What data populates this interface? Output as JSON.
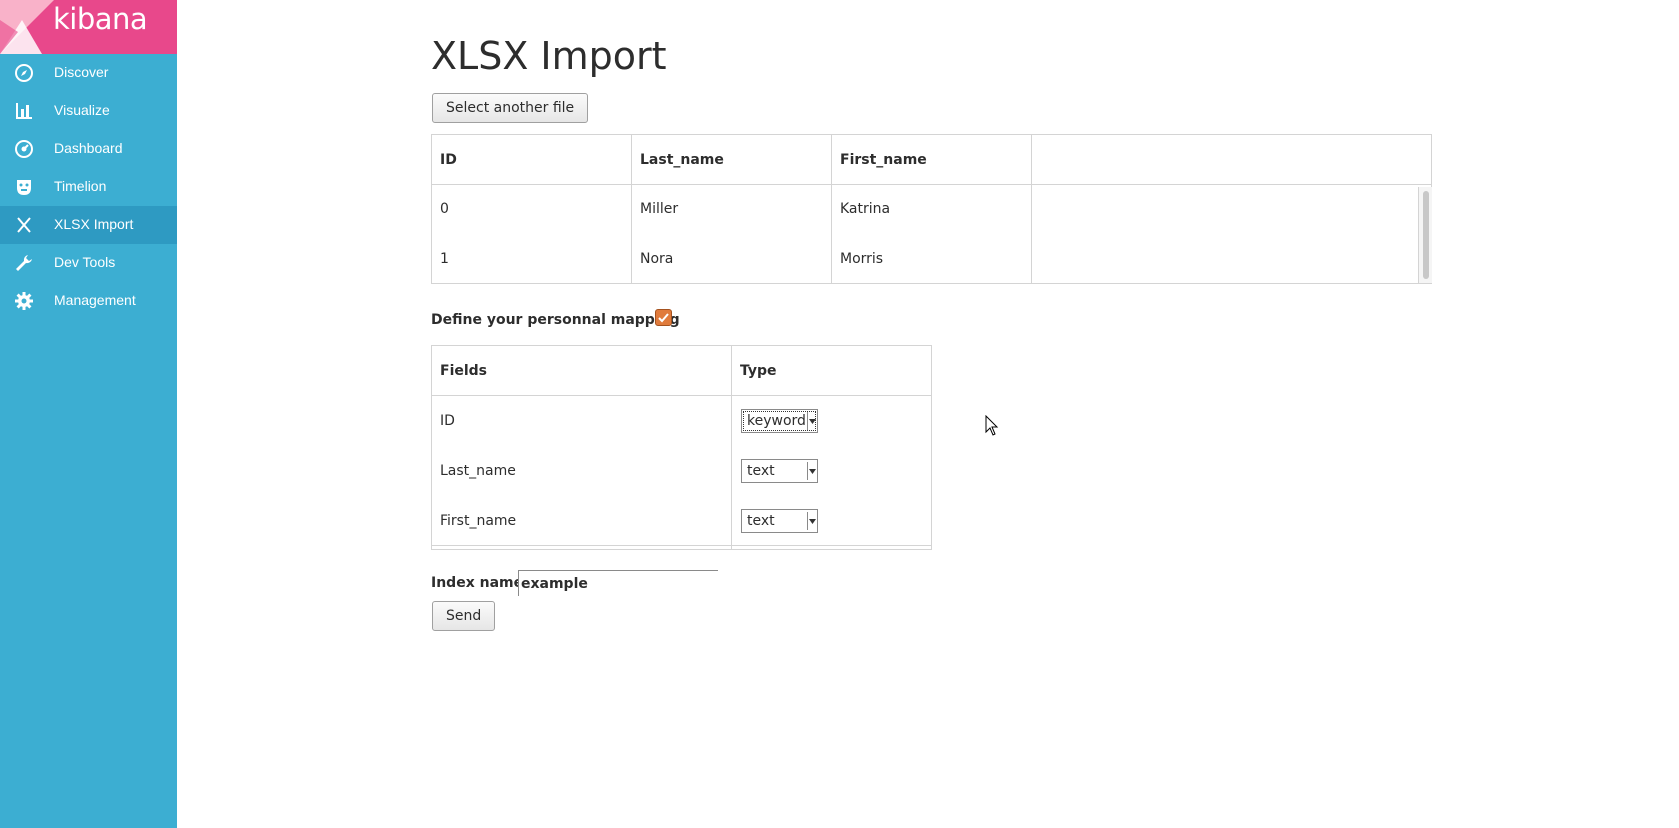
{
  "brand": {
    "name": "kibana",
    "colors": {
      "brand_bg": "#e8488b",
      "sidebar_bg": "#3caed2",
      "active_bg": "#2e9ac2"
    }
  },
  "sidebar": {
    "items": [
      {
        "label": "Discover",
        "icon": "compass-icon",
        "active": false
      },
      {
        "label": "Visualize",
        "icon": "bar-chart-icon",
        "active": false
      },
      {
        "label": "Dashboard",
        "icon": "dashboard-gauge-icon",
        "active": false
      },
      {
        "label": "Timelion",
        "icon": "timelion-mask-icon",
        "active": false
      },
      {
        "label": "XLSX Import",
        "icon": "x-icon",
        "active": true
      },
      {
        "label": "Dev Tools",
        "icon": "wrench-icon",
        "active": false
      },
      {
        "label": "Management",
        "icon": "gear-icon",
        "active": false
      }
    ]
  },
  "main": {
    "title": "XLSX Import",
    "select_file_label": "Select another file",
    "preview": {
      "columns": [
        "ID",
        "Last_name",
        "First_name",
        ""
      ],
      "rows": [
        [
          "0",
          "Miller",
          "Katrina"
        ],
        [
          "1",
          "Nora",
          "Morris"
        ]
      ]
    },
    "mapping": {
      "label": "Define your personnal mapping",
      "checked": true,
      "columns": [
        "Fields",
        "Type"
      ],
      "rows": [
        {
          "field": "ID",
          "type": "keyword"
        },
        {
          "field": "Last_name",
          "type": "text"
        },
        {
          "field": "First_name",
          "type": "text"
        }
      ]
    },
    "index": {
      "label": "Index name",
      "value": "example"
    },
    "send_label": "Send"
  }
}
